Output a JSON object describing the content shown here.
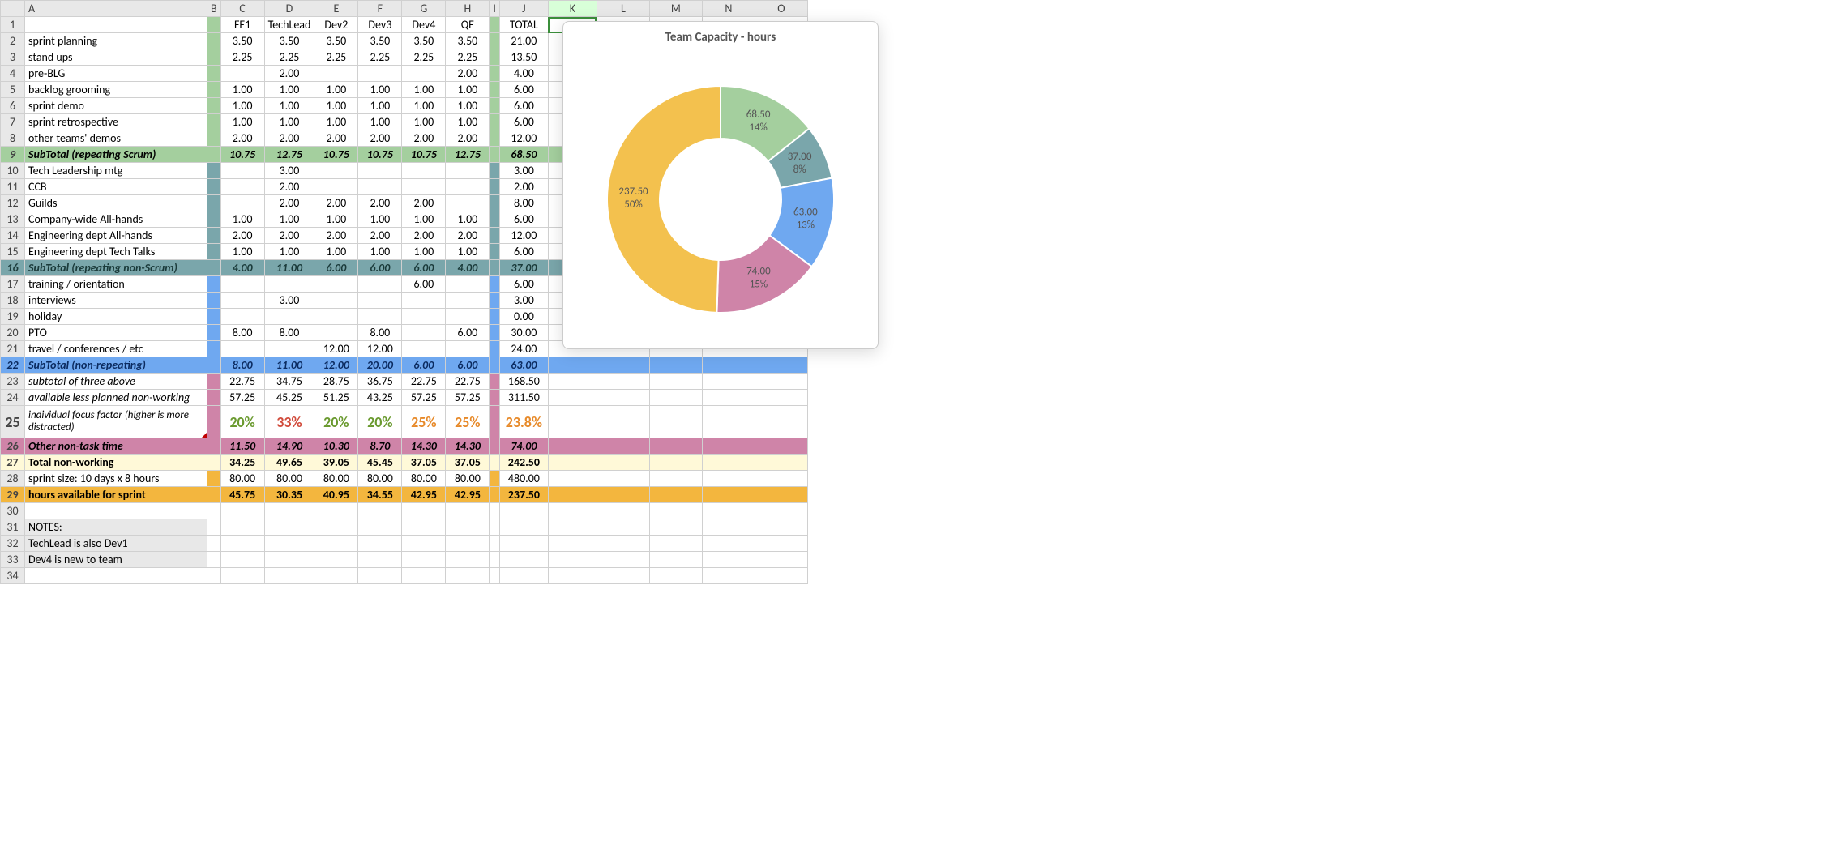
{
  "columns": [
    "",
    "A",
    "B",
    "C",
    "D",
    "E",
    "F",
    "G",
    "H",
    "I",
    "J",
    "K",
    "L",
    "M",
    "N",
    "O"
  ],
  "headerRow": {
    "A": "",
    "C": "FE1",
    "D": "TechLead",
    "E": "Dev2",
    "F": "Dev3",
    "G": "Dev4",
    "H": "QE",
    "J": "TOTAL"
  },
  "rows": [
    {
      "n": 2,
      "cls": "scrum",
      "A": "sprint planning",
      "C": "3.50",
      "D": "3.50",
      "E": "3.50",
      "F": "3.50",
      "G": "3.50",
      "H": "3.50",
      "J": "21.00"
    },
    {
      "n": 3,
      "cls": "scrum",
      "A": "stand ups",
      "C": "2.25",
      "D": "2.25",
      "E": "2.25",
      "F": "2.25",
      "G": "2.25",
      "H": "2.25",
      "J": "13.50"
    },
    {
      "n": 4,
      "cls": "scrum",
      "A": "pre-BLG",
      "C": "",
      "D": "2.00",
      "E": "",
      "F": "",
      "G": "",
      "H": "2.00",
      "J": "4.00"
    },
    {
      "n": 5,
      "cls": "scrum",
      "A": "backlog grooming",
      "C": "1.00",
      "D": "1.00",
      "E": "1.00",
      "F": "1.00",
      "G": "1.00",
      "H": "1.00",
      "J": "6.00"
    },
    {
      "n": 6,
      "cls": "scrum",
      "A": "sprint demo",
      "C": "1.00",
      "D": "1.00",
      "E": "1.00",
      "F": "1.00",
      "G": "1.00",
      "H": "1.00",
      "J": "6.00"
    },
    {
      "n": 7,
      "cls": "scrum",
      "A": "sprint retrospective",
      "C": "1.00",
      "D": "1.00",
      "E": "1.00",
      "F": "1.00",
      "G": "1.00",
      "H": "1.00",
      "J": "6.00"
    },
    {
      "n": 8,
      "cls": "scrum",
      "A": "other teams' demos",
      "C": "2.00",
      "D": "2.00",
      "E": "2.00",
      "F": "2.00",
      "G": "2.00",
      "H": "2.00",
      "J": "12.00"
    },
    {
      "n": 9,
      "cls": "scrumHdr subnum",
      "A": "SubTotal (repeating Scrum)",
      "C": "10.75",
      "D": "12.75",
      "E": "10.75",
      "F": "10.75",
      "G": "10.75",
      "H": "12.75",
      "J": "68.50"
    },
    {
      "n": 10,
      "cls": "nonscrum",
      "A": "Tech Leadership mtg",
      "C": "",
      "D": "3.00",
      "E": "",
      "F": "",
      "G": "",
      "H": "",
      "J": "3.00"
    },
    {
      "n": 11,
      "cls": "nonscrum",
      "A": "CCB",
      "C": "",
      "D": "2.00",
      "E": "",
      "F": "",
      "G": "",
      "H": "",
      "J": "2.00"
    },
    {
      "n": 12,
      "cls": "nonscrum",
      "A": "Guilds",
      "C": "",
      "D": "2.00",
      "E": "2.00",
      "F": "2.00",
      "G": "2.00",
      "H": "",
      "J": "8.00"
    },
    {
      "n": 13,
      "cls": "nonscrum",
      "A": "Company-wide All-hands",
      "C": "1.00",
      "D": "1.00",
      "E": "1.00",
      "F": "1.00",
      "G": "1.00",
      "H": "1.00",
      "J": "6.00"
    },
    {
      "n": 14,
      "cls": "nonscrum",
      "A": "Engineering dept All-hands",
      "C": "2.00",
      "D": "2.00",
      "E": "2.00",
      "F": "2.00",
      "G": "2.00",
      "H": "2.00",
      "J": "12.00"
    },
    {
      "n": 15,
      "cls": "nonscrum",
      "A": "Engineering dept Tech Talks",
      "C": "1.00",
      "D": "1.00",
      "E": "1.00",
      "F": "1.00",
      "G": "1.00",
      "H": "1.00",
      "J": "6.00"
    },
    {
      "n": 16,
      "cls": "nonscrumHdr subnum",
      "A": "SubTotal (repeating non-Scrum)",
      "C": "4.00",
      "D": "11.00",
      "E": "6.00",
      "F": "6.00",
      "G": "6.00",
      "H": "4.00",
      "J": "37.00"
    },
    {
      "n": 17,
      "cls": "nonrepeat",
      "A": "training / orientation",
      "C": "",
      "D": "",
      "E": "",
      "F": "",
      "G": "6.00",
      "H": "",
      "J": "6.00"
    },
    {
      "n": 18,
      "cls": "nonrepeat",
      "A": "interviews",
      "C": "",
      "D": "3.00",
      "E": "",
      "F": "",
      "G": "",
      "H": "",
      "J": "3.00"
    },
    {
      "n": 19,
      "cls": "nonrepeat",
      "A": "holiday",
      "C": "",
      "D": "",
      "E": "",
      "F": "",
      "G": "",
      "H": "",
      "J": "0.00"
    },
    {
      "n": 20,
      "cls": "nonrepeat",
      "A": "PTO",
      "C": "8.00",
      "D": "8.00",
      "E": "",
      "F": "8.00",
      "G": "",
      "H": "6.00",
      "J": "30.00"
    },
    {
      "n": 21,
      "cls": "nonrepeat",
      "A": "travel / conferences / etc",
      "C": "",
      "D": "",
      "E": "12.00",
      "F": "12.00",
      "G": "",
      "H": "",
      "J": "24.00"
    },
    {
      "n": 22,
      "cls": "nonrepeatHdr subnum",
      "A": "SubTotal (non-repeating)",
      "C": "8.00",
      "D": "11.00",
      "E": "12.00",
      "F": "20.00",
      "G": "6.00",
      "H": "6.00",
      "J": "63.00"
    },
    {
      "n": 23,
      "cls": "three",
      "A": "subtotal of three above",
      "C": "22.75",
      "D": "34.75",
      "E": "28.75",
      "F": "36.75",
      "G": "22.75",
      "H": "22.75",
      "J": "168.50"
    },
    {
      "n": 24,
      "cls": "three",
      "A": "available less planned non-working",
      "C": "57.25",
      "D": "45.25",
      "E": "51.25",
      "F": "43.25",
      "G": "57.25",
      "H": "57.25",
      "J": "311.50"
    },
    {
      "n": 25,
      "cls": "three focusrow",
      "A": "individual focus factor\n(higher is more distracted)",
      "C": "20%",
      "D": "33%",
      "E": "20%",
      "F": "20%",
      "G": "25%",
      "H": "25%",
      "J": "23.8%",
      "colorC": "focus-g",
      "colorD": "focus-r",
      "colorE": "focus-g",
      "colorF": "focus-g",
      "colorG": "focus-o",
      "colorH": "focus-o",
      "colorJ": "focus-o",
      "tall": true,
      "tri": true
    },
    {
      "n": 26,
      "cls": "otherHdr subnum",
      "A": "Other non-task time",
      "C": "11.50",
      "D": "14.90",
      "E": "10.30",
      "F": "8.70",
      "G": "14.30",
      "H": "14.30",
      "J": "74.00"
    },
    {
      "n": 27,
      "cls": "totalnon",
      "A": "Total non-working",
      "C": "34.25",
      "D": "49.65",
      "E": "39.05",
      "F": "45.45",
      "G": "37.05",
      "H": "37.05",
      "J": "242.50"
    },
    {
      "n": 28,
      "cls": "sprintsize",
      "A": "sprint size: 10 days x 8 hours",
      "C": "80.00",
      "D": "80.00",
      "E": "80.00",
      "F": "80.00",
      "G": "80.00",
      "H": "80.00",
      "J": "480.00"
    },
    {
      "n": 29,
      "cls": "hoursavail",
      "A": "hours available for sprint",
      "C": "45.75",
      "D": "30.35",
      "E": "40.95",
      "F": "34.55",
      "G": "42.95",
      "H": "42.95",
      "J": "237.50"
    },
    {
      "n": 30,
      "cls": "",
      "A": ""
    },
    {
      "n": 31,
      "cls": "",
      "A": "NOTES:",
      "shade": true
    },
    {
      "n": 32,
      "cls": "",
      "A": "TechLead is also Dev1",
      "shade": true
    },
    {
      "n": 33,
      "cls": "",
      "A": "Dev4 is new to team",
      "shade": true
    }
  ],
  "selectedCell": "K1",
  "chart_data": {
    "type": "pie",
    "subtype": "doughnut",
    "title": "Team Capacity - hours",
    "slices": [
      {
        "value": 68.5,
        "percent": "14%",
        "color": "#a4cf9e"
      },
      {
        "value": 37.0,
        "percent": "8%",
        "color": "#7aa6ab"
      },
      {
        "value": 63.0,
        "percent": "13%",
        "color": "#6fa8f0"
      },
      {
        "value": 74.0,
        "percent": "15%",
        "color": "#cf84a8"
      },
      {
        "value": 237.5,
        "percent": "50%",
        "color": "#f3c14e"
      }
    ]
  }
}
